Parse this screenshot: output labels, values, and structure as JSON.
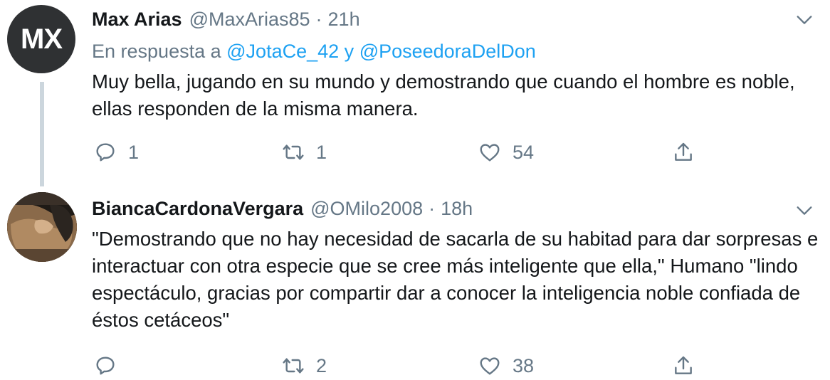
{
  "tweets": [
    {
      "avatar_text": "MX",
      "name": "Max Arias",
      "handle": "@MaxArias85",
      "separator": "·",
      "time": "21h",
      "reply_prefix": "En respuesta a",
      "mention_1": "@JotaCe_42",
      "reply_joiner": "y",
      "mention_2": "@PoseedoraDelDon",
      "text": "Muy bella, jugando en su mundo y demostrando que cuando el hombre es noble, ellas responden de la misma manera.",
      "replies": "1",
      "retweets": "1",
      "likes": "54"
    },
    {
      "avatar_caption": "",
      "name": "BiancaCardonaVergara",
      "handle": "@OMilo2008",
      "separator": "·",
      "time": "18h",
      "text": "\"Demostrando que no hay necesidad de sacarla de su habitad para dar sorpresas e interactuar con otra especie que se cree más inteligente que ella,\" Humano \"lindo espectáculo, gracias por compartir dar a conocer la inteligencia noble confiada de éstos cetáceos\"",
      "replies": "",
      "retweets": "2",
      "likes": "38"
    }
  ],
  "colors": {
    "text": "#14171a",
    "secondary": "#657786",
    "link": "#1da1f2",
    "thread_line": "#ccd6dd"
  },
  "icons": [
    "chevron-down-icon",
    "reply-icon",
    "retweet-icon",
    "like-icon",
    "share-icon"
  ]
}
